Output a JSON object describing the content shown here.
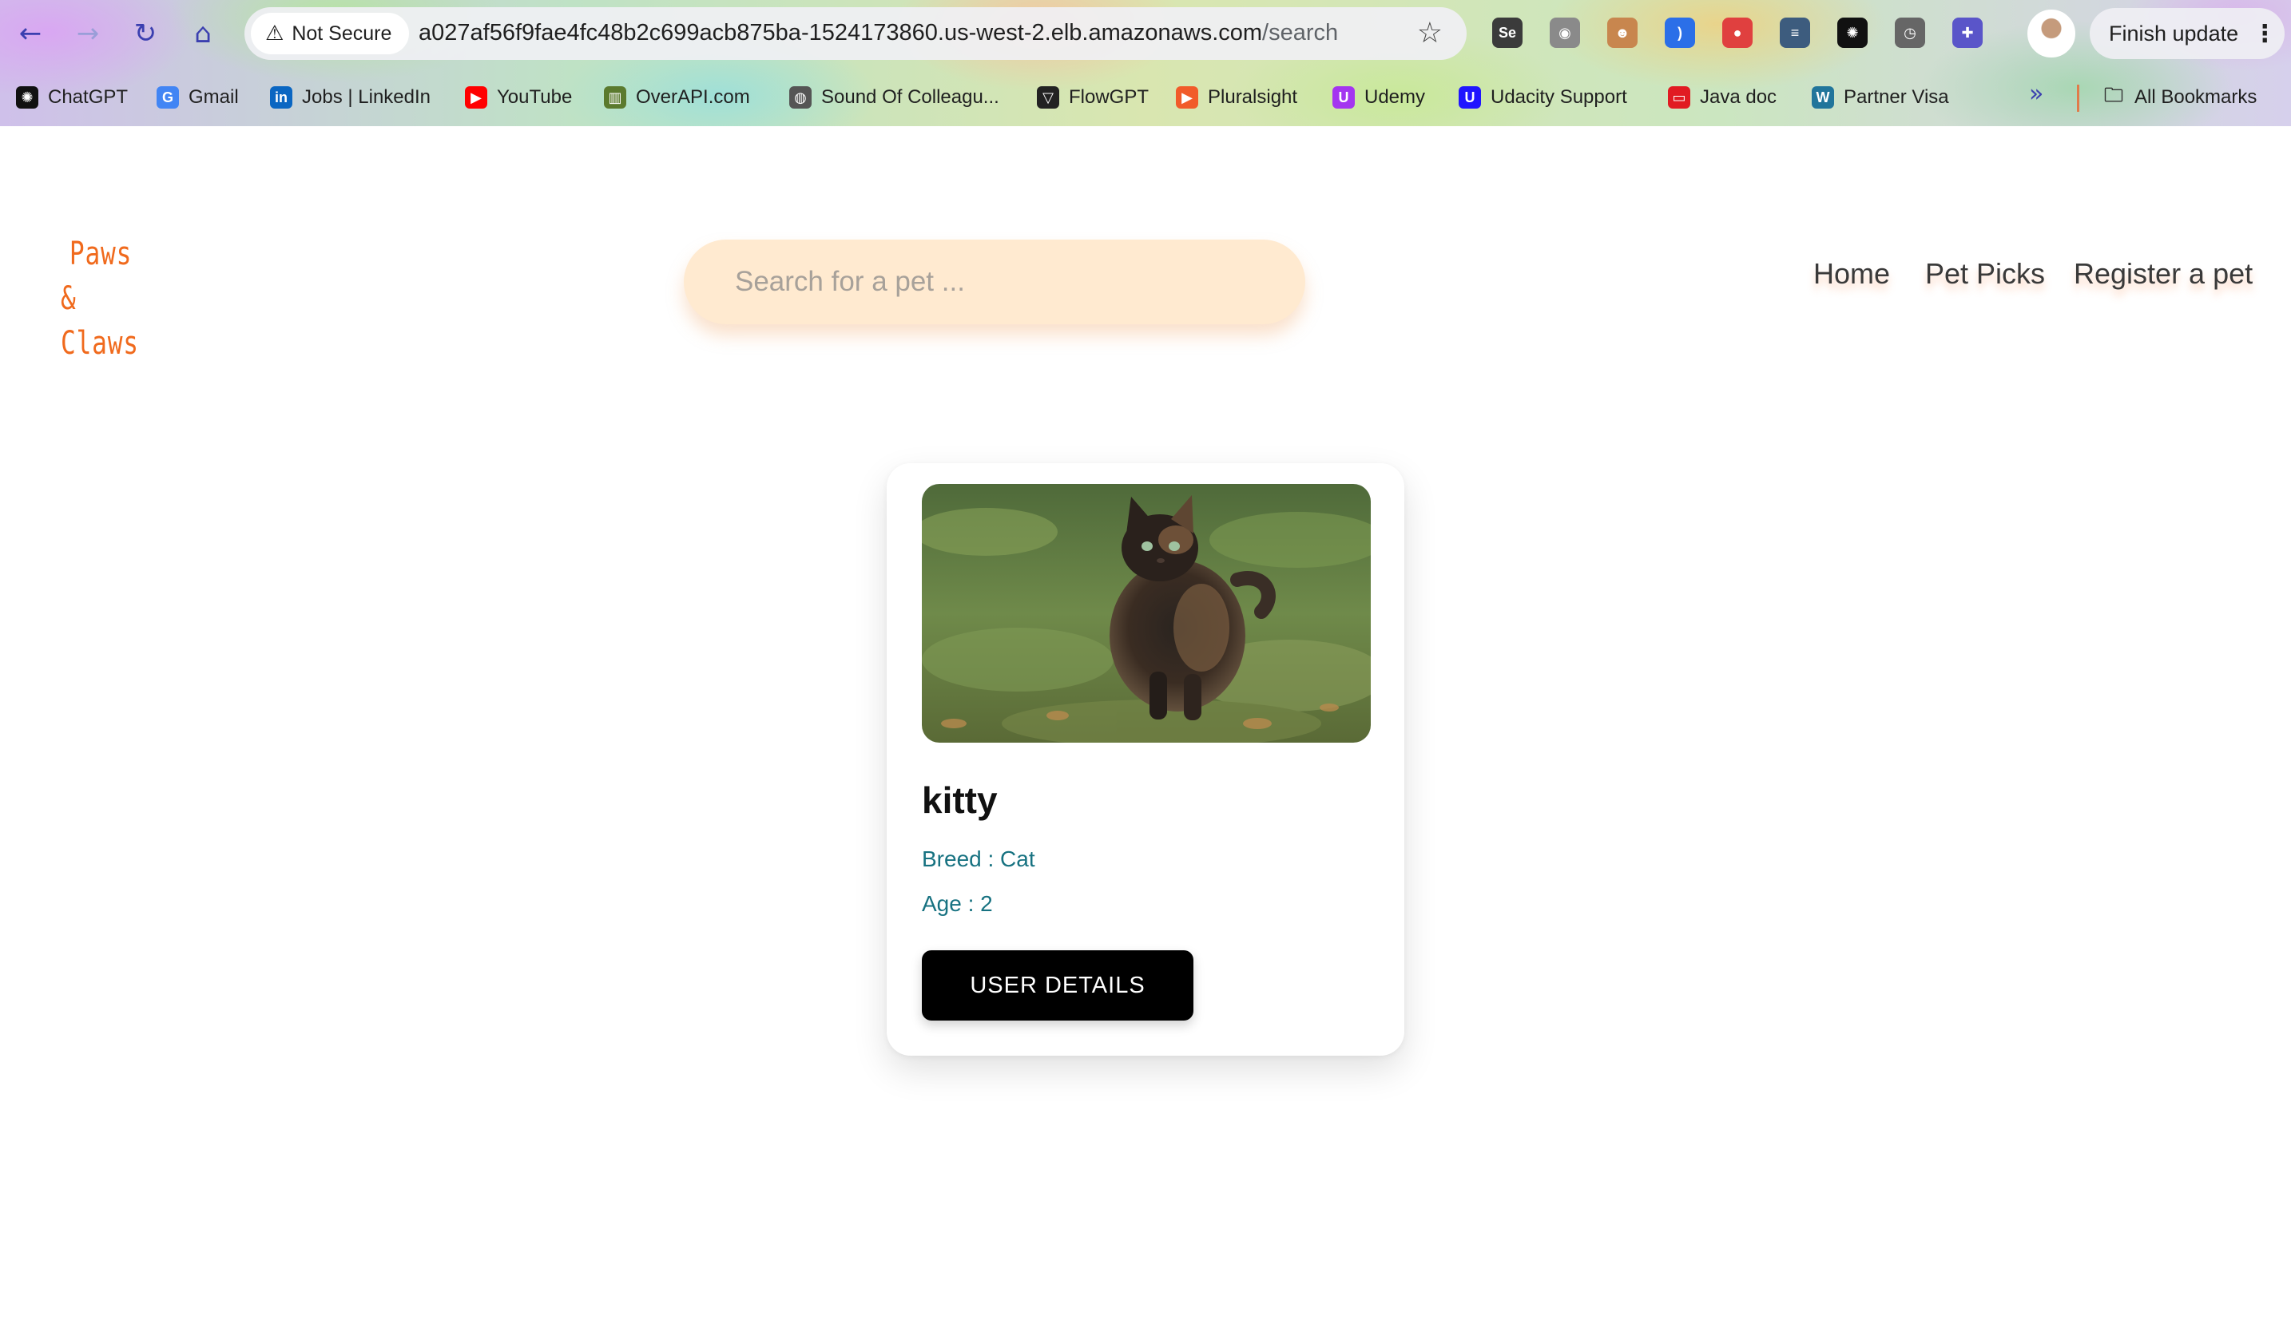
{
  "browser": {
    "security_label": "Not Secure",
    "url_host": "a027af56f9fae4fc48b2c699acb875ba-1524173860.us-west-2.elb.amazonaws.com",
    "url_path": "/search",
    "finish_update_label": "Finish update",
    "nav_icons": [
      "back-arrow-icon",
      "forward-arrow-icon",
      "reload-icon",
      "home-icon"
    ],
    "extensions": [
      {
        "name": "selenium-extension-icon",
        "glyph": "Se",
        "color": "#3b3b3b"
      },
      {
        "name": "camera-extension-icon",
        "glyph": "◉",
        "color": "#8a8a8a"
      },
      {
        "name": "mask-extension-icon",
        "glyph": "☻",
        "color": "#c8864e"
      },
      {
        "name": "voice-extension-icon",
        "glyph": ")",
        "color": "#2b6fe8"
      },
      {
        "name": "color-extension-icon",
        "glyph": "●",
        "color": "#e0403f"
      },
      {
        "name": "chat-extension-icon",
        "glyph": "≡",
        "color": "#3d5c7e"
      },
      {
        "name": "openai-extension-icon",
        "glyph": "✺",
        "color": "#111111"
      },
      {
        "name": "timer-extension-icon",
        "glyph": "◷",
        "color": "#666666"
      },
      {
        "name": "puzzle-extensions-icon",
        "glyph": "✚",
        "color": "#5a55c9"
      }
    ],
    "bookmarks": [
      {
        "label": "ChatGPT",
        "icon": "chatgpt-icon",
        "color": "#111111",
        "glyph": "✺"
      },
      {
        "label": "Gmail",
        "icon": "google-icon",
        "color": "#4285f4",
        "glyph": "G"
      },
      {
        "label": "Jobs | LinkedIn",
        "icon": "linkedin-icon",
        "color": "#0a66c2",
        "glyph": "in"
      },
      {
        "label": "YouTube",
        "icon": "youtube-icon",
        "color": "#ff0000",
        "glyph": "▶"
      },
      {
        "label": "OverAPI.com",
        "icon": "overapi-icon",
        "color": "#5b7a2e",
        "glyph": "▥"
      },
      {
        "label": "Sound Of Colleagu...",
        "icon": "globe-icon",
        "color": "#555555",
        "glyph": "◍"
      },
      {
        "label": "FlowGPT",
        "icon": "flowgpt-icon",
        "color": "#222222",
        "glyph": "▽"
      },
      {
        "label": "Pluralsight",
        "icon": "pluralsight-icon",
        "color": "#f15b2a",
        "glyph": "▶"
      },
      {
        "label": "Udemy",
        "icon": "udemy-icon",
        "color": "#a435f0",
        "glyph": "U"
      },
      {
        "label": "Udacity Support",
        "icon": "udacity-icon",
        "color": "#2015ff",
        "glyph": "U"
      },
      {
        "label": "Java doc",
        "icon": "java-icon",
        "color": "#e11b22",
        "glyph": "▭"
      },
      {
        "label": "Partner Visa",
        "icon": "wordpress-icon",
        "color": "#21759b",
        "glyph": "W"
      }
    ],
    "more_bookmarks_glyph": "»",
    "all_bookmarks_label": "All Bookmarks"
  },
  "site": {
    "logo_line1": "Paws",
    "logo_line2": "& Claws",
    "search_placeholder": "Search for a pet ...",
    "nav": [
      "Home",
      "Pet Picks",
      "Register a pet"
    ]
  },
  "results": [
    {
      "name": "kitty",
      "breed_text": "Breed : Cat",
      "age_text": "Age : 2",
      "button_label": "USER DETAILS"
    }
  ],
  "colors": {
    "logo": "#f06a1d",
    "search_bg": "#ffead0",
    "meta_text": "#177281",
    "button_bg": "#000000"
  }
}
